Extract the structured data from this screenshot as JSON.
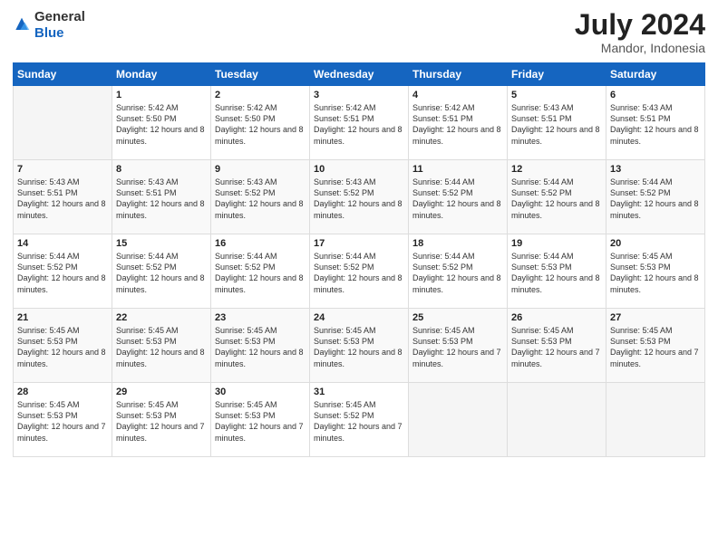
{
  "logo": {
    "general": "General",
    "blue": "Blue"
  },
  "header": {
    "month_year": "July 2024",
    "location": "Mandor, Indonesia"
  },
  "days_of_week": [
    "Sunday",
    "Monday",
    "Tuesday",
    "Wednesday",
    "Thursday",
    "Friday",
    "Saturday"
  ],
  "weeks": [
    [
      null,
      {
        "day": "1",
        "sunrise": "5:42 AM",
        "sunset": "5:50 PM",
        "daylight": "12 hours and 8 minutes."
      },
      {
        "day": "2",
        "sunrise": "5:42 AM",
        "sunset": "5:50 PM",
        "daylight": "12 hours and 8 minutes."
      },
      {
        "day": "3",
        "sunrise": "5:42 AM",
        "sunset": "5:51 PM",
        "daylight": "12 hours and 8 minutes."
      },
      {
        "day": "4",
        "sunrise": "5:42 AM",
        "sunset": "5:51 PM",
        "daylight": "12 hours and 8 minutes."
      },
      {
        "day": "5",
        "sunrise": "5:43 AM",
        "sunset": "5:51 PM",
        "daylight": "12 hours and 8 minutes."
      },
      {
        "day": "6",
        "sunrise": "5:43 AM",
        "sunset": "5:51 PM",
        "daylight": "12 hours and 8 minutes."
      }
    ],
    [
      {
        "day": "7",
        "sunrise": "5:43 AM",
        "sunset": "5:51 PM",
        "daylight": "12 hours and 8 minutes."
      },
      {
        "day": "8",
        "sunrise": "5:43 AM",
        "sunset": "5:51 PM",
        "daylight": "12 hours and 8 minutes."
      },
      {
        "day": "9",
        "sunrise": "5:43 AM",
        "sunset": "5:52 PM",
        "daylight": "12 hours and 8 minutes."
      },
      {
        "day": "10",
        "sunrise": "5:43 AM",
        "sunset": "5:52 PM",
        "daylight": "12 hours and 8 minutes."
      },
      {
        "day": "11",
        "sunrise": "5:44 AM",
        "sunset": "5:52 PM",
        "daylight": "12 hours and 8 minutes."
      },
      {
        "day": "12",
        "sunrise": "5:44 AM",
        "sunset": "5:52 PM",
        "daylight": "12 hours and 8 minutes."
      },
      {
        "day": "13",
        "sunrise": "5:44 AM",
        "sunset": "5:52 PM",
        "daylight": "12 hours and 8 minutes."
      }
    ],
    [
      {
        "day": "14",
        "sunrise": "5:44 AM",
        "sunset": "5:52 PM",
        "daylight": "12 hours and 8 minutes."
      },
      {
        "day": "15",
        "sunrise": "5:44 AM",
        "sunset": "5:52 PM",
        "daylight": "12 hours and 8 minutes."
      },
      {
        "day": "16",
        "sunrise": "5:44 AM",
        "sunset": "5:52 PM",
        "daylight": "12 hours and 8 minutes."
      },
      {
        "day": "17",
        "sunrise": "5:44 AM",
        "sunset": "5:52 PM",
        "daylight": "12 hours and 8 minutes."
      },
      {
        "day": "18",
        "sunrise": "5:44 AM",
        "sunset": "5:52 PM",
        "daylight": "12 hours and 8 minutes."
      },
      {
        "day": "19",
        "sunrise": "5:44 AM",
        "sunset": "5:53 PM",
        "daylight": "12 hours and 8 minutes."
      },
      {
        "day": "20",
        "sunrise": "5:45 AM",
        "sunset": "5:53 PM",
        "daylight": "12 hours and 8 minutes."
      }
    ],
    [
      {
        "day": "21",
        "sunrise": "5:45 AM",
        "sunset": "5:53 PM",
        "daylight": "12 hours and 8 minutes."
      },
      {
        "day": "22",
        "sunrise": "5:45 AM",
        "sunset": "5:53 PM",
        "daylight": "12 hours and 8 minutes."
      },
      {
        "day": "23",
        "sunrise": "5:45 AM",
        "sunset": "5:53 PM",
        "daylight": "12 hours and 8 minutes."
      },
      {
        "day": "24",
        "sunrise": "5:45 AM",
        "sunset": "5:53 PM",
        "daylight": "12 hours and 8 minutes."
      },
      {
        "day": "25",
        "sunrise": "5:45 AM",
        "sunset": "5:53 PM",
        "daylight": "12 hours and 7 minutes."
      },
      {
        "day": "26",
        "sunrise": "5:45 AM",
        "sunset": "5:53 PM",
        "daylight": "12 hours and 7 minutes."
      },
      {
        "day": "27",
        "sunrise": "5:45 AM",
        "sunset": "5:53 PM",
        "daylight": "12 hours and 7 minutes."
      }
    ],
    [
      {
        "day": "28",
        "sunrise": "5:45 AM",
        "sunset": "5:53 PM",
        "daylight": "12 hours and 7 minutes."
      },
      {
        "day": "29",
        "sunrise": "5:45 AM",
        "sunset": "5:53 PM",
        "daylight": "12 hours and 7 minutes."
      },
      {
        "day": "30",
        "sunrise": "5:45 AM",
        "sunset": "5:53 PM",
        "daylight": "12 hours and 7 minutes."
      },
      {
        "day": "31",
        "sunrise": "5:45 AM",
        "sunset": "5:52 PM",
        "daylight": "12 hours and 7 minutes."
      },
      null,
      null,
      null
    ]
  ],
  "cell_labels": {
    "sunrise": "Sunrise:",
    "sunset": "Sunset:",
    "daylight": "Daylight:"
  }
}
